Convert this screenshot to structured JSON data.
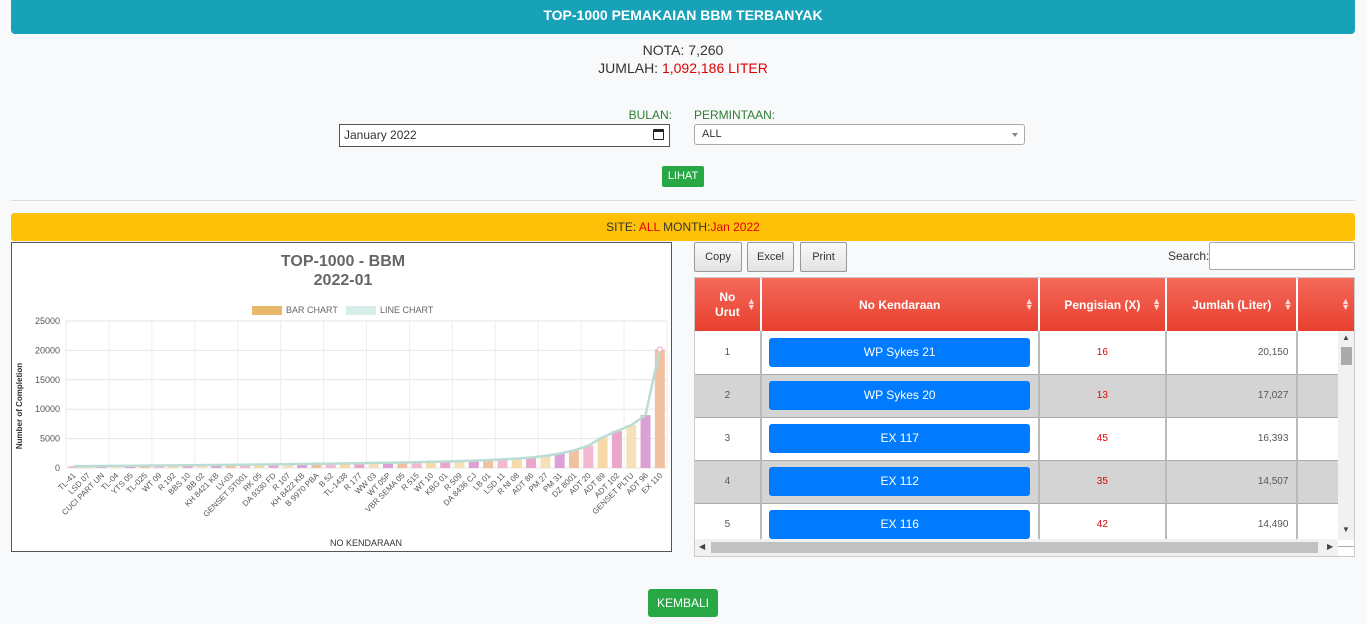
{
  "header": {
    "title": "TOP-1000 PEMAKAIAN BBM TERBANYAK"
  },
  "stats": {
    "nota_label": "NOTA:",
    "nota_value": "7,260",
    "jumlah_label": "JUMLAH:",
    "jumlah_value": "1,092,186 LITER"
  },
  "filters": {
    "bulan_label": "BULAN:",
    "bulan_value": "January 2022",
    "permintaan_label": "PERMINTAAN:",
    "permintaan_value": "ALL",
    "lihat_label": "LIHAT"
  },
  "sitebar": {
    "site_label": "SITE:",
    "site_value": "ALL",
    "month_label": "MONTH:",
    "month_value": "Jan 2022"
  },
  "colors": {
    "header": "#17a2b8",
    "sitebar": "#ffc107",
    "button_green": "#28a745",
    "table_header": "#f4695b",
    "vehicle_button": "#007bff"
  },
  "chart_data": {
    "type": "bar",
    "title": "TOP-1000 - BBM",
    "subtitle": "2022-01",
    "xlabel": "NO KENDARAAN",
    "ylabel": "Number of Completion",
    "ylim": [
      0,
      25000
    ],
    "yticks": [
      0,
      5000,
      10000,
      15000,
      20000,
      25000
    ],
    "grid": true,
    "legend_position": "top",
    "series": [
      {
        "name": "BAR CHART",
        "color": "#e8b86a"
      },
      {
        "name": "LINE CHART",
        "color": "#d6ede9"
      }
    ],
    "categories": [
      "TL-41",
      "LSD 07",
      "CUCI PART UN",
      "TL-04",
      "YTS 05",
      "TL-025",
      "WT 09",
      "R 192",
      "BBS 10",
      "BB 02",
      "KH 8421 KB",
      "LV-03",
      "GENSET ST001",
      "RK 05",
      "DA 9330 FD",
      "R 107",
      "KH 8422 KB",
      "B 9970 PBA",
      "B 52",
      "TL-1438",
      "R 177",
      "WW 03",
      "WT 05P",
      "VBR SEMA 05",
      "R 515",
      "WT 10",
      "KBG 01",
      "R 509",
      "DA 8436 CJ",
      "LB 01",
      "LSD 11",
      "R NI 08",
      "ADT 86",
      "PM 27",
      "PM 31",
      "DZ 8001",
      "ADT 20",
      "ADT 89",
      "ADT 102",
      "GENSET PLTU",
      "ADT 96",
      "EX 110"
    ],
    "values": [
      300,
      320,
      340,
      360,
      380,
      400,
      420,
      450,
      470,
      490,
      510,
      530,
      560,
      590,
      620,
      650,
      680,
      710,
      740,
      780,
      820,
      860,
      900,
      940,
      990,
      1050,
      1110,
      1180,
      1260,
      1350,
      1460,
      1600,
      1780,
      2050,
      2450,
      3000,
      3800,
      5200,
      6300,
      7300,
      9000,
      20150
    ]
  },
  "table": {
    "tools": {
      "copy": "Copy",
      "excel": "Excel",
      "print": "Print",
      "search_label": "Search:"
    },
    "columns": [
      "No Urut",
      "No Kendaraan",
      "Pengisian (X)",
      "Jumlah (Liter)"
    ],
    "rows": [
      {
        "no": "1",
        "vehicle": "WP Sykes 21",
        "pengisian": "16",
        "jumlah": "20,150"
      },
      {
        "no": "2",
        "vehicle": "WP Sykes 20",
        "pengisian": "13",
        "jumlah": "17,027"
      },
      {
        "no": "3",
        "vehicle": "EX 117",
        "pengisian": "45",
        "jumlah": "16,393"
      },
      {
        "no": "4",
        "vehicle": "EX 112",
        "pengisian": "35",
        "jumlah": "14,507"
      },
      {
        "no": "5",
        "vehicle": "EX 116",
        "pengisian": "42",
        "jumlah": "14,490"
      }
    ]
  },
  "footer": {
    "kembali_label": "KEMBALI"
  }
}
